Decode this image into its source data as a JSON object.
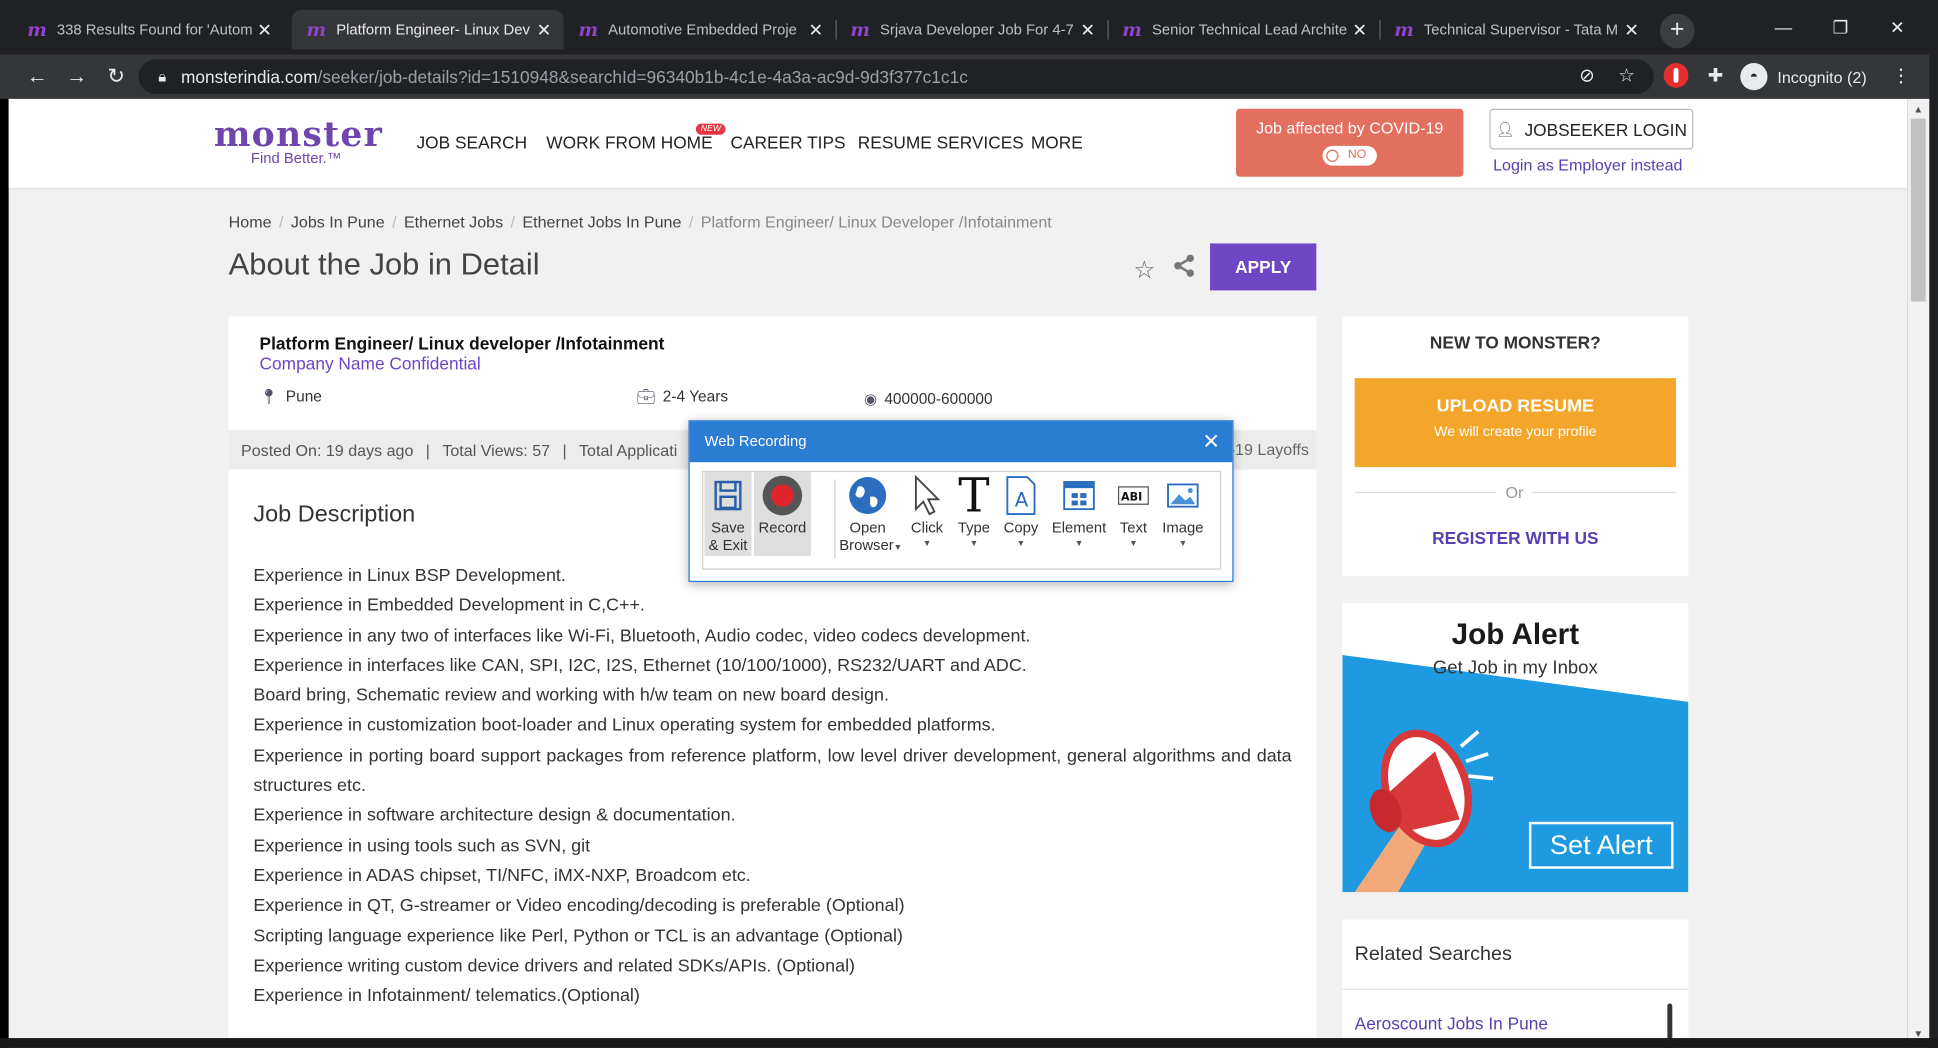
{
  "browser": {
    "tabs": [
      {
        "title": "338 Results Found for 'Autom",
        "active": false
      },
      {
        "title": "Platform Engineer- Linux Dev",
        "active": true
      },
      {
        "title": "Automotive Embedded Proje",
        "active": false
      },
      {
        "title": "Srjava Developer Job For 4-7",
        "active": false
      },
      {
        "title": "Senior Technical Lead Archite",
        "active": false
      },
      {
        "title": "Technical Supervisor - Tata M",
        "active": false
      }
    ],
    "url_host": "monsterindia.com",
    "url_path": "/seeker/job-details?id=1510948&searchId=96340b1b-4c1e-4a3a-ac9d-9d3f377c1c1c",
    "incognito_label": "Incognito (2)"
  },
  "header": {
    "logo_word": "monster",
    "logo_tag": "Find Better.™",
    "nav": [
      "JOB SEARCH",
      "WORK FROM HOME",
      "CAREER TIPS",
      "RESUME SERVICES",
      "MORE"
    ],
    "new_badge": "NEW",
    "covid_label": "Job affected by COVID-19",
    "covid_toggle": "NO",
    "login_label": "JOBSEEKER LOGIN",
    "employer_link": "Login as Employer instead"
  },
  "breadcrumb": [
    "Home",
    "Jobs In Pune",
    "Ethernet Jobs",
    "Ethernet Jobs In Pune",
    "Platform Engineer/ Linux Developer /Infotainment"
  ],
  "page_title": "About the Job in Detail",
  "apply_label": "APPLY",
  "job": {
    "title": "Platform Engineer/ Linux developer /Infotainment",
    "company": "Company Name Confidential",
    "location": "Pune",
    "experience": "2-4 Years",
    "salary": "400000-600000",
    "posted": "Posted On: 19 days ago",
    "views": "Total Views: 57",
    "applications": "Total Applicati",
    "layoffs": "-19 Layoffs"
  },
  "jd": {
    "heading": "Job Description",
    "items": [
      "Experience in Linux BSP Development.",
      "Experience in Embedded Development in C,C++.",
      "Experience in any two of interfaces like Wi-Fi, Bluetooth, Audio codec, video codecs development.",
      "Experience in interfaces like CAN, SPI, I2C, I2S, Ethernet (10/100/1000), RS232/UART and ADC.",
      "Board bring, Schematic review and working with h/w team on new board design.",
      "Experience in customization boot-loader and Linux operating system for embedded platforms.",
      "Experience in porting board support packages from reference platform, low level driver development, general algorithms and data structures etc.",
      "Experience in software architecture design & documentation.",
      "Experience in using tools such as SVN, git",
      "Experience in ADAS chipset, TI/NFC, iMX-NXP, Broadcom etc.",
      "Experience in QT, G-streamer or Video encoding/decoding is preferable (Optional)",
      "Scripting language experience like Perl, Python or TCL is an advantage (Optional)",
      "Experience writing custom device drivers and related SDKs/APIs. (Optional)",
      "Experience in Infotainment/ telematics.(Optional)"
    ]
  },
  "sidebar": {
    "new_heading": "NEW TO MONSTER?",
    "upload_label": "UPLOAD RESUME",
    "upload_sub": "We will create your profile",
    "or_label": "Or",
    "register_label": "REGISTER WITH US",
    "alert_heading": "Job Alert",
    "alert_sub": "Get Job in my Inbox",
    "alert_button": "Set Alert",
    "related_heading": "Related Searches",
    "related_link": "Aeroscount Jobs In Pune"
  },
  "recorder": {
    "title": "Web Recording",
    "tools": [
      {
        "label": "Save & Exit",
        "icon": "save-icon"
      },
      {
        "label": "Record",
        "icon": "record-icon"
      },
      {
        "label": "Open Browser",
        "icon": "globe-icon"
      },
      {
        "label": "Click",
        "icon": "cursor-icon"
      },
      {
        "label": "Type",
        "icon": "type-icon"
      },
      {
        "label": "Copy",
        "icon": "copy-icon"
      },
      {
        "label": "Element",
        "icon": "element-icon"
      },
      {
        "label": "Text",
        "icon": "text-icon"
      },
      {
        "label": "Image",
        "icon": "image-icon"
      }
    ],
    "save_l1": "Save",
    "save_l2": "& Exit",
    "open_l1": "Open",
    "open_l2": "Browser"
  },
  "colors": {
    "brand": "#6e46c5",
    "upload": "#f4a62a",
    "covid": "#e3705f",
    "recorder": "#2b7cd3",
    "alert_blue": "#1e9be0"
  }
}
